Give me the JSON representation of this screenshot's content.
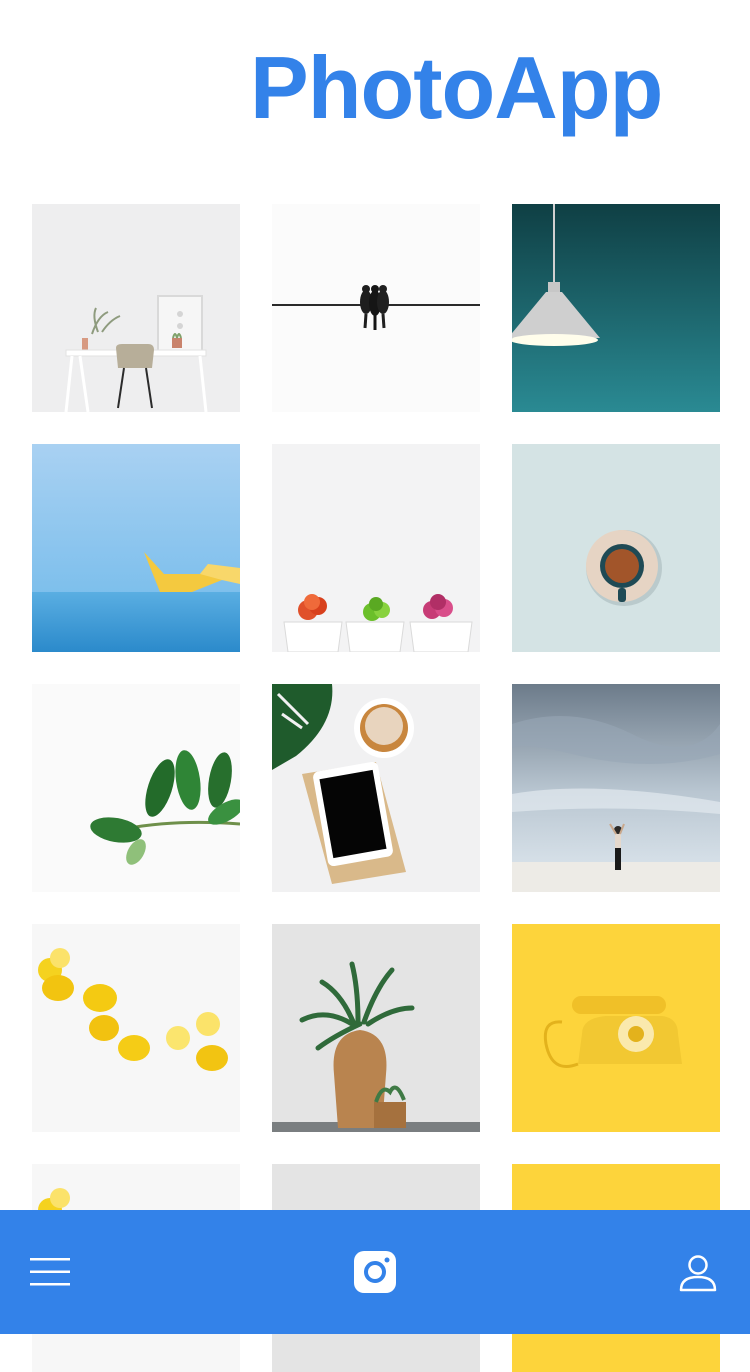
{
  "header": {
    "title": "PhotoApp"
  },
  "colors": {
    "accent": "#3382E9",
    "background": "#FFFFFF",
    "icon": "#FFFFFF"
  },
  "grid": {
    "photos": [
      {
        "icon": "desk-chair-photo"
      },
      {
        "icon": "birds-on-wire-photo"
      },
      {
        "icon": "pendant-lamp-photo"
      },
      {
        "icon": "paper-boat-photo"
      },
      {
        "icon": "succulent-pots-photo"
      },
      {
        "icon": "coffee-cup-photo"
      },
      {
        "icon": "leaf-branch-photo"
      },
      {
        "icon": "tablet-coffee-photo"
      },
      {
        "icon": "beach-person-photo"
      },
      {
        "icon": "lemons-photo"
      },
      {
        "icon": "plant-vase-photo"
      },
      {
        "icon": "yellow-telephone-photo"
      },
      {
        "icon": "lemons-photo"
      },
      {
        "icon": "plant-vase-photo"
      },
      {
        "icon": "yellow-telephone-photo"
      }
    ]
  },
  "bottom_nav": {
    "items": [
      {
        "icon": "menu-icon"
      },
      {
        "icon": "camera-icon"
      },
      {
        "icon": "profile-icon"
      }
    ]
  }
}
